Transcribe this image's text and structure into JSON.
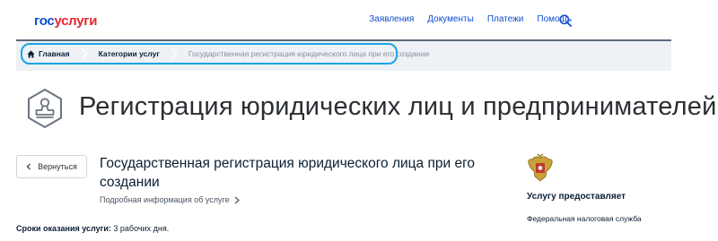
{
  "header": {
    "logo_part1": "гос",
    "logo_part2": "услуги",
    "nav": [
      "Заявления",
      "Документы",
      "Платежи",
      "Помощь"
    ],
    "search_icon": "search-icon"
  },
  "breadcrumbs": {
    "home": "Главная",
    "category": "Категории услуг",
    "current": "Государственная регистрация юридического лица при его создании"
  },
  "page_title": "Регистрация юридических лиц и предпринимателей",
  "back_label": "Вернуться",
  "service": {
    "title": "Государственная регистрация юридического лица при его создании",
    "details_link": "Подробная информация об услуге",
    "term_label": "Сроки оказания услуги:",
    "term_value": " 3 рабочих дня."
  },
  "provider": {
    "label": "Услугу предоставляет",
    "name": "Федеральная налоговая служба"
  },
  "colors": {
    "brand_blue": "#0d4cd3",
    "brand_red": "#e4282f",
    "highlight": "#1aa3e6"
  }
}
